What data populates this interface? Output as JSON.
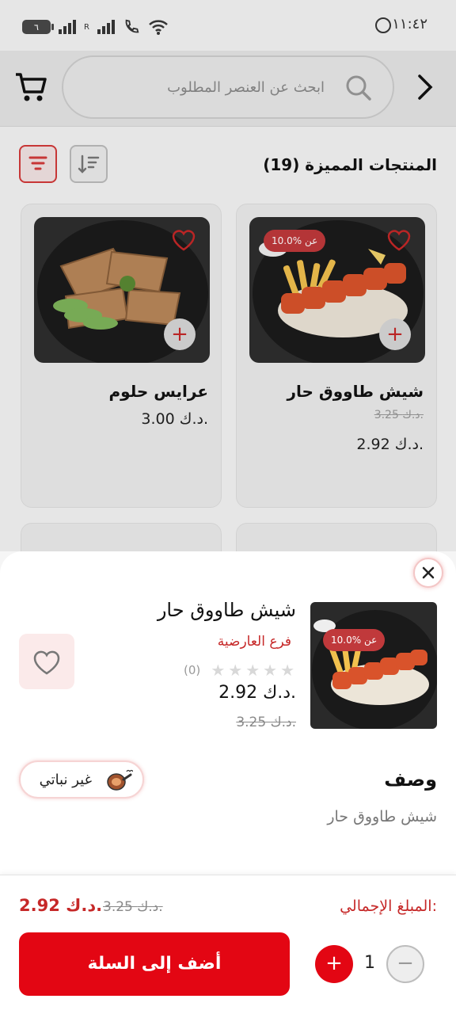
{
  "status_bar": {
    "battery": "٦",
    "network_label": "R",
    "time": "١١:٤٢"
  },
  "search": {
    "placeholder": "ابحث عن العنصر المطلوب"
  },
  "featured": {
    "title": "المنتجات المميزة (19)"
  },
  "products": [
    {
      "name": "شيش طاووق حار",
      "old_price": "3.25 د.ك.",
      "price": "2.92 د.ك.",
      "badge": "10.0% عن"
    },
    {
      "name": "عرايس حلوم",
      "price": "3.00 د.ك."
    }
  ],
  "sheet": {
    "title": "شيش طاووق حار",
    "branch": "فرع العارضية",
    "review_count": "(0)",
    "price": "2.92 د.ك.",
    "old_price": "3.25 د.ك.",
    "badge": "10.0% عن",
    "veg_label": "غير نباتي",
    "desc_heading": "وصف",
    "desc_text": "شيش طاووق حار"
  },
  "footer": {
    "total_label": "المبلغ الإجمالي:",
    "total_price": "2.92 د.ك.",
    "total_old": "3.25 د.ك.",
    "add_button": "أضف إلى السلة",
    "quantity": "1"
  },
  "colors": {
    "accent": "#e30613",
    "accent_text": "#c62828"
  },
  "icons": [
    "cart-icon",
    "search-icon",
    "chevron-right-icon",
    "filter-icon",
    "sort-icon",
    "heart-icon",
    "plus-icon",
    "close-icon",
    "star-icon",
    "meat-icon",
    "minus-icon"
  ]
}
